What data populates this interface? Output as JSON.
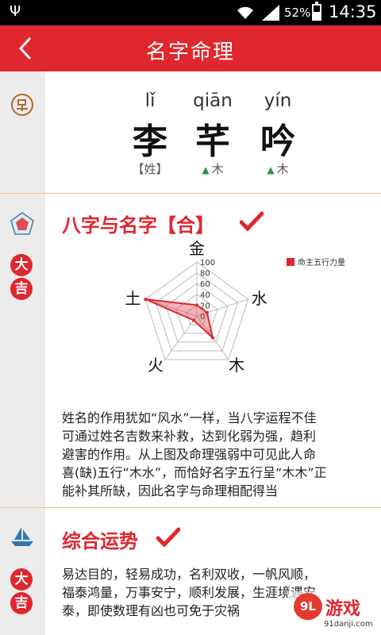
{
  "status": {
    "battery": "52%",
    "time": "14:35"
  },
  "header": {
    "title": "名字命理"
  },
  "name": {
    "chars": [
      {
        "pinyin": "lǐ",
        "hanzi": "李",
        "element": "【姓】",
        "icon": ""
      },
      {
        "pinyin": "qiān",
        "hanzi": "芊",
        "element": "木",
        "icon": "tree-icon"
      },
      {
        "pinyin": "yín",
        "hanzi": "吟",
        "element": "木",
        "icon": "tree-icon"
      }
    ]
  },
  "section1": {
    "title": "八字与名字【合】",
    "badge": [
      "大",
      "吉"
    ],
    "paragraph": [
      "姓名的作用犹如“风水”一样，当八字运程不佳",
      "可通过姓名吉数来补救，达到化弱为强，趋利",
      "避害的作用。从上图及命理强弱中可见此人命",
      "喜(缺)五行“木水”，而恰好名字五行呈“木木”正",
      "能补其所缺，因此名字与命理相配得当"
    ]
  },
  "chart_data": {
    "type": "radar",
    "axes": [
      "金",
      "水",
      "木",
      "火",
      "土"
    ],
    "ticks": [
      0,
      20,
      40,
      60,
      80,
      100
    ],
    "range": [
      0,
      100
    ],
    "series": [
      {
        "name": "命主五行力量",
        "values": [
          20,
          20,
          50,
          10,
          100
        ],
        "color": "#e0262e"
      }
    ]
  },
  "section2": {
    "title": "综合运势",
    "badge": [
      "大",
      "吉"
    ],
    "paragraph": [
      "易达目的，轻易成功，名利双收，一帆风顺，",
      "福泰鸿量，万事安宁，顺利发展，生涯境遇安",
      "泰，即使数理有凶也可免于灾祸"
    ]
  },
  "watermark": {
    "logo": "9L",
    "brand": "游戏",
    "url": "91danji.com"
  }
}
